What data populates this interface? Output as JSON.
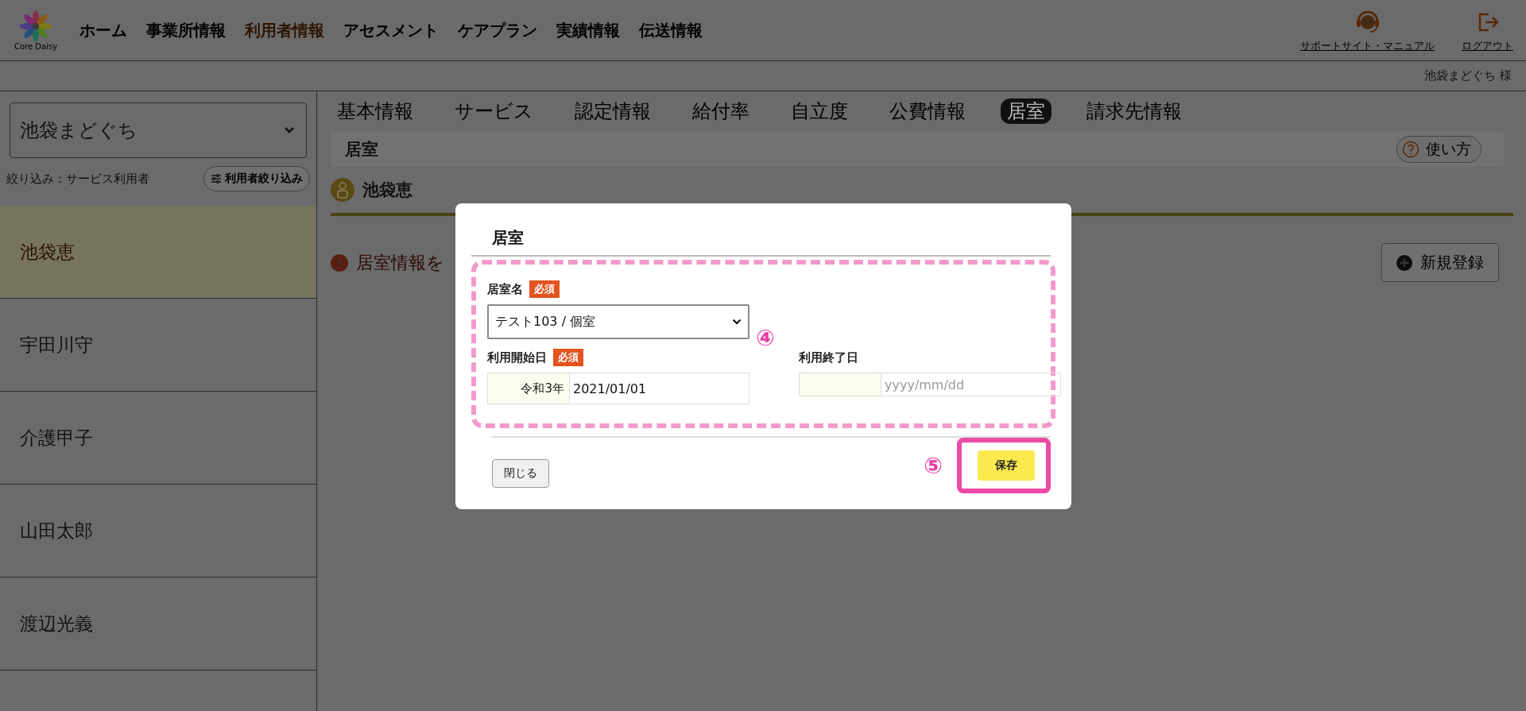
{
  "header": {
    "logo_text": "Core Daisy",
    "nav": [
      {
        "label": "ホーム",
        "selected": false
      },
      {
        "label": "事業所情報",
        "selected": false
      },
      {
        "label": "利用者情報",
        "selected": true
      },
      {
        "label": "アセスメント",
        "selected": false
      },
      {
        "label": "ケアプラン",
        "selected": false
      },
      {
        "label": "実績情報",
        "selected": false
      },
      {
        "label": "伝送情報",
        "selected": false
      }
    ],
    "support_link": "サポートサイト・マニュアル",
    "logout_link": "ログアウト",
    "user_name": "池袋まどぐち 様"
  },
  "sidebar": {
    "office_select": "池袋まどぐち",
    "filter_label": "絞り込み：サービス利用者",
    "filter_button": "利用者絞り込み",
    "users": [
      {
        "name": "池袋恵",
        "selected": true
      },
      {
        "name": "宇田川守",
        "selected": false
      },
      {
        "name": "介護甲子",
        "selected": false
      },
      {
        "name": "山田太郎",
        "selected": false
      },
      {
        "name": "渡辺光義",
        "selected": false
      }
    ]
  },
  "content": {
    "tabs": [
      {
        "label": "基本情報",
        "selected": false
      },
      {
        "label": "サービス",
        "selected": false
      },
      {
        "label": "認定情報",
        "selected": false
      },
      {
        "label": "給付率",
        "selected": false
      },
      {
        "label": "自立度",
        "selected": false
      },
      {
        "label": "公費情報",
        "selected": false
      },
      {
        "label": "居室",
        "selected": true
      },
      {
        "label": "請求先情報",
        "selected": false
      }
    ],
    "page_title": "居室",
    "help_button": "使い方",
    "person_name": "池袋恵",
    "notice": "居室情報を",
    "new_button": "新規登録"
  },
  "modal": {
    "title": "居室",
    "fields": [
      {
        "kind": "select",
        "label": "居室名",
        "required_badge": "必須",
        "value": "テスト103 / 個室"
      },
      {
        "kind": "date",
        "label": "利用開始日",
        "required_badge": "必須",
        "era": "令和3年",
        "value": "2021/01/01"
      },
      {
        "kind": "date",
        "label": "利用終了日",
        "placeholder": "yyyy/mm/dd"
      }
    ],
    "form_annotation": "④",
    "close_button": "閉じる",
    "save_button": "保存",
    "save_annotation": "⑤"
  }
}
